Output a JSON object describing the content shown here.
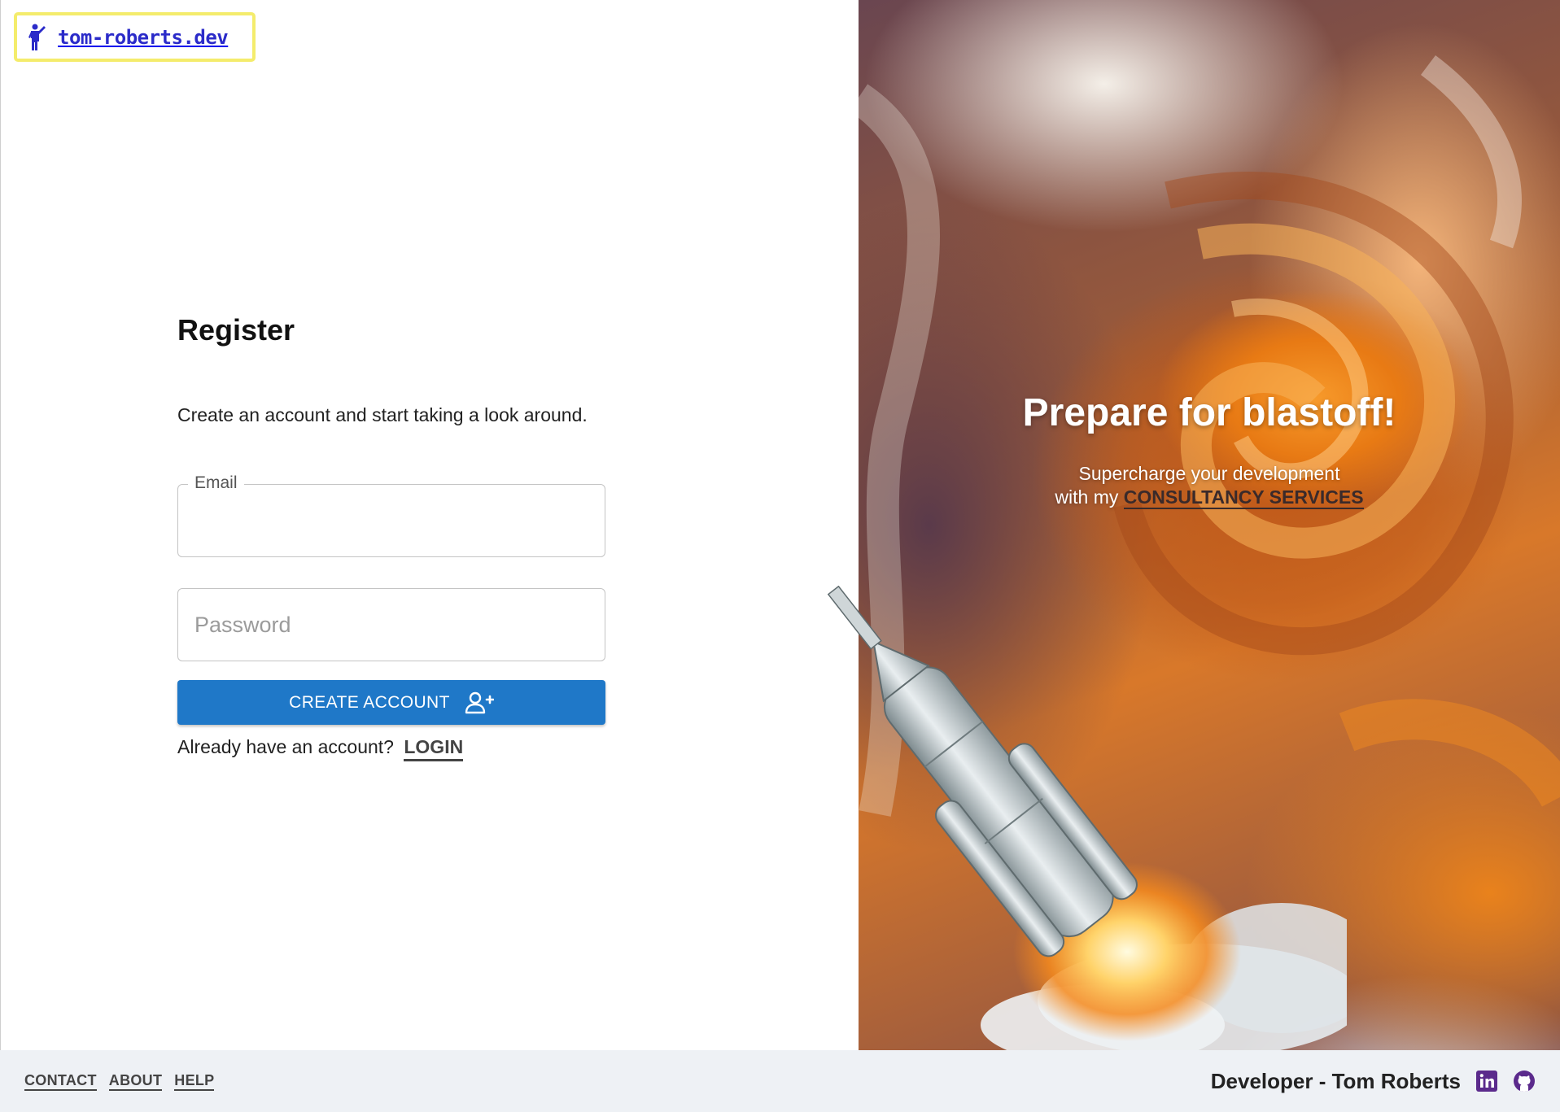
{
  "brand": {
    "logo_text": "tom-roberts.dev",
    "logo_icon": "person-waving-icon"
  },
  "register": {
    "title": "Register",
    "subtitle": "Create an account and start taking a look around.",
    "email_label": "Email",
    "email_value": "",
    "password_placeholder": "Password",
    "create_button_label": "CREATE ACCOUNT",
    "create_button_icon": "add-user-icon",
    "login_prompt": "Already have an account?",
    "login_link": "LOGIN"
  },
  "hero": {
    "title": "Prepare for blastoff!",
    "line1": "Supercharge your development",
    "line2_prefix": "with my",
    "consult_link": "CONSULTANCY SERVICES"
  },
  "footer": {
    "links": [
      "CONTACT",
      "ABOUT",
      "HELP"
    ],
    "developer_label": "Developer - Tom Roberts",
    "social_icons": [
      "linkedin-icon",
      "github-icon"
    ]
  },
  "colors": {
    "primary_button": "#1f78c8",
    "logo_border": "#f4ec6c",
    "logo_text": "#2b2bc9",
    "social_icon": "#5b2a8c",
    "footer_bg": "#eef1f5"
  }
}
